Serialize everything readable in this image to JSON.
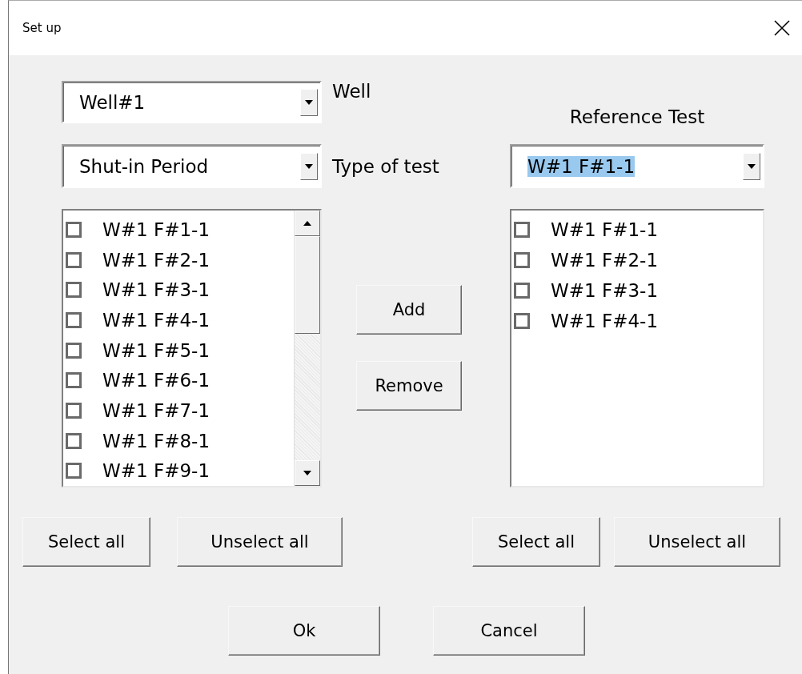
{
  "window": {
    "title": "Set up"
  },
  "well": {
    "value": "Well#1",
    "label": "Well"
  },
  "test_type": {
    "value": "Shut-in Period",
    "label": "Type of test"
  },
  "reference": {
    "label": "Reference Test",
    "value": "W#1 F#1-1",
    "highlighted": true
  },
  "left_list": {
    "items": [
      {
        "label": "W#1 F#1-1",
        "checked": false
      },
      {
        "label": "W#1 F#2-1",
        "checked": false
      },
      {
        "label": "W#1 F#3-1",
        "checked": false
      },
      {
        "label": "W#1 F#4-1",
        "checked": false
      },
      {
        "label": "W#1 F#5-1",
        "checked": false
      },
      {
        "label": "W#1 F#6-1",
        "checked": false
      },
      {
        "label": "W#1 F#7-1",
        "checked": false
      },
      {
        "label": "W#1 F#8-1",
        "checked": false
      },
      {
        "label": "W#1 F#9-1",
        "checked": false
      }
    ]
  },
  "middle_buttons": [
    "Add",
    "Remove"
  ],
  "right_list": {
    "items": [
      {
        "label": "W#1 F#1-1",
        "checked": false
      },
      {
        "label": "W#1 F#2-1",
        "checked": false
      },
      {
        "label": "W#1 F#3-1",
        "checked": false
      },
      {
        "label": "W#1 F#4-1",
        "checked": false
      }
    ]
  },
  "left_buttons": [
    "Select all",
    "Unselect all"
  ],
  "right_buttons": [
    "Select all",
    "Unselect all"
  ],
  "footer_buttons": [
    "Ok",
    "Cancel"
  ]
}
